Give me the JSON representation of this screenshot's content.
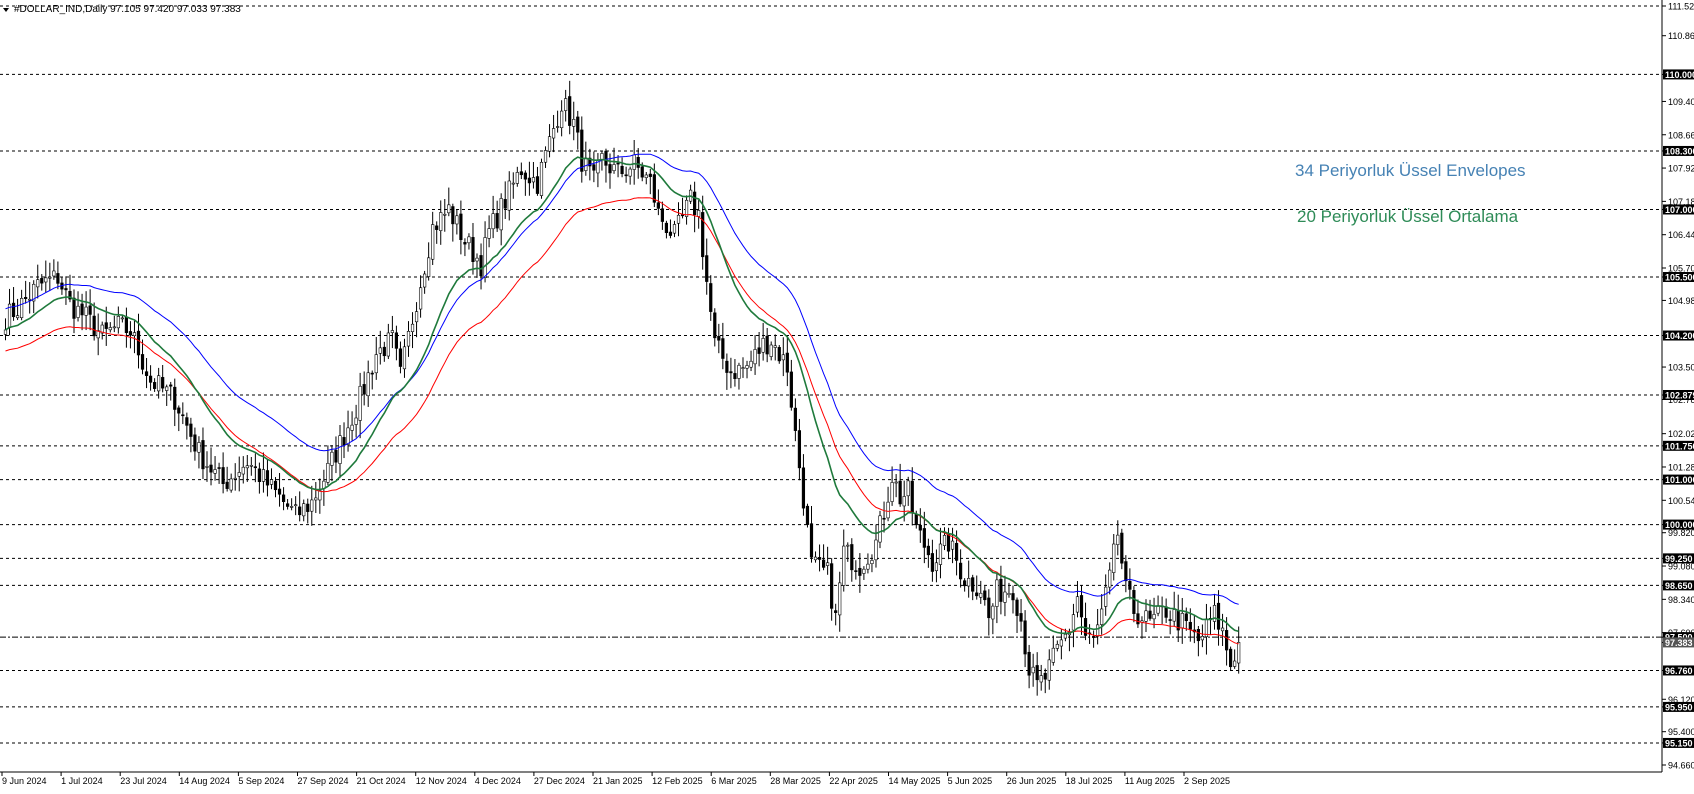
{
  "header": {
    "symbol": "#DOLLAR_IND",
    "timeframe": "Daily",
    "ohlc": "97.105 97.420 97.033 97.383"
  },
  "chart_data": {
    "type": "candlestick",
    "ylim": [
      94.66,
      111.52
    ],
    "y_ticks": [
      "111.520",
      "110.860",
      "110.000",
      "109.400",
      "108.660",
      "108.300",
      "107.920",
      "107.180",
      "107.000",
      "106.440",
      "105.700",
      "105.500",
      "104.980",
      "104.200",
      "103.500",
      "102.879",
      "102.780",
      "102.020",
      "101.750",
      "101.280",
      "101.000",
      "100.540",
      "100.000",
      "99.820",
      "99.250",
      "99.080",
      "98.650",
      "98.340",
      "97.600",
      "97.500",
      "97.383",
      "96.760",
      "96.120",
      "95.950",
      "95.400",
      "95.150",
      "94.660"
    ],
    "boxed_levels": [
      "110.000",
      "108.300",
      "107.000",
      "105.500",
      "104.200",
      "102.879",
      "101.750",
      "101.000",
      "100.000",
      "99.250",
      "98.650",
      "97.500",
      "96.760",
      "95.950",
      "95.150"
    ],
    "current_price": "97.383",
    "grid": false,
    "x_labels": [
      "9 Jun 2024",
      "1 Jul 2024",
      "23 Jul 2024",
      "14 Aug 2024",
      "5 Sep 2024",
      "27 Sep 2024",
      "21 Oct 2024",
      "12 Nov 2024",
      "4 Dec 2024",
      "27 Dec 2024",
      "21 Jan 2025",
      "12 Feb 2025",
      "6 Mar 2025",
      "28 Mar 2025",
      "22 Apr 2025",
      "14 May 2025",
      "5 Jun 2025",
      "26 Jun 2025",
      "18 Jul 2025",
      "11 Aug 2025",
      "2 Sep 2025"
    ],
    "price_path": [
      [
        0,
        104.6
      ],
      [
        3,
        104.8
      ],
      [
        8,
        105.3
      ],
      [
        13,
        105.5
      ],
      [
        16,
        104.9
      ],
      [
        20,
        104.6
      ],
      [
        24,
        104.2
      ],
      [
        28,
        104.4
      ],
      [
        31,
        104.3
      ],
      [
        36,
        103.2
      ],
      [
        42,
        102.8
      ],
      [
        48,
        101.6
      ],
      [
        54,
        100.9
      ],
      [
        60,
        101.4
      ],
      [
        66,
        100.8
      ],
      [
        72,
        100.2
      ],
      [
        76,
        100.5
      ],
      [
        80,
        101.2
      ],
      [
        84,
        102.0
      ],
      [
        88,
        102.8
      ],
      [
        92,
        103.8
      ],
      [
        96,
        104.1
      ],
      [
        98,
        103.3
      ],
      [
        102,
        105.0
      ],
      [
        106,
        106.6
      ],
      [
        110,
        107.0
      ],
      [
        114,
        106.3
      ],
      [
        118,
        105.8
      ],
      [
        120,
        106.5
      ],
      [
        124,
        107.2
      ],
      [
        128,
        107.9
      ],
      [
        132,
        107.6
      ],
      [
        136,
        108.8
      ],
      [
        138,
        109.4
      ],
      [
        141,
        108.9
      ],
      [
        143,
        108.1
      ],
      [
        146,
        107.6
      ],
      [
        148,
        108.1
      ],
      [
        152,
        107.8
      ],
      [
        156,
        108.0
      ],
      [
        160,
        107.6
      ],
      [
        162,
        106.9
      ],
      [
        166,
        106.4
      ],
      [
        170,
        107.2
      ],
      [
        172,
        106.9
      ],
      [
        174,
        105.4
      ],
      [
        176,
        104.0
      ],
      [
        180,
        103.4
      ],
      [
        184,
        103.5
      ],
      [
        188,
        104.0
      ],
      [
        190,
        104.1
      ],
      [
        194,
        103.5
      ],
      [
        196,
        102.0
      ],
      [
        198,
        100.6
      ],
      [
        200,
        99.1
      ],
      [
        204,
        98.9
      ],
      [
        206,
        97.9
      ],
      [
        208,
        99.4
      ],
      [
        212,
        99.1
      ],
      [
        216,
        99.6
      ],
      [
        218,
        100.3
      ],
      [
        220,
        101.1
      ],
      [
        222,
        100.6
      ],
      [
        224,
        100.7
      ],
      [
        226,
        99.9
      ],
      [
        230,
        99.2
      ],
      [
        234,
        99.6
      ],
      [
        238,
        98.8
      ],
      [
        242,
        98.6
      ],
      [
        244,
        97.9
      ],
      [
        246,
        98.5
      ],
      [
        250,
        98.6
      ],
      [
        252,
        97.9
      ],
      [
        254,
        96.8
      ],
      [
        256,
        96.4
      ],
      [
        258,
        96.6
      ],
      [
        260,
        97.0
      ],
      [
        264,
        97.7
      ],
      [
        266,
        98.4
      ],
      [
        268,
        97.5
      ],
      [
        270,
        97.4
      ],
      [
        272,
        98.0
      ],
      [
        274,
        98.8
      ],
      [
        276,
        99.8
      ],
      [
        278,
        98.5
      ],
      [
        280,
        98.1
      ],
      [
        284,
        97.8
      ],
      [
        288,
        98.1
      ],
      [
        292,
        97.8
      ],
      [
        296,
        97.4
      ],
      [
        300,
        98.0
      ],
      [
        302,
        97.6
      ],
      [
        304,
        96.9
      ],
      [
        306,
        97.383
      ]
    ],
    "series": [
      {
        "name": "34 Periyorluk Üssel Envelopes",
        "color": "#4682b4"
      },
      {
        "name": "20 Periyorluk Üssel Ortalama",
        "color": "#2e8b57"
      }
    ],
    "indicator_colors": {
      "upper_envelope": "#0000ff",
      "lower_envelope": "#ff0000",
      "ema": "#1f7a3c"
    }
  }
}
